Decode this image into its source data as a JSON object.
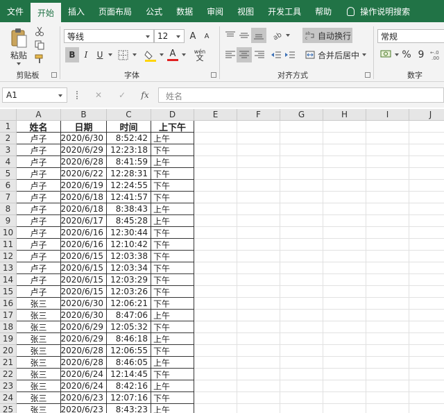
{
  "ribbon": {
    "tabs": [
      "文件",
      "开始",
      "插入",
      "页面布局",
      "公式",
      "数据",
      "审阅",
      "视图",
      "开发工具",
      "帮助"
    ],
    "active_tab": "开始",
    "search_label": "操作说明搜索",
    "clipboard": {
      "paste_label": "粘贴",
      "group_label": "剪贴板"
    },
    "font": {
      "family": "等线",
      "size": "12",
      "bold": "B",
      "italic": "I",
      "underline": "U",
      "color_letter": "A",
      "grow": "A",
      "shrink": "A",
      "wen": "wén",
      "wen_char": "文",
      "group_label": "字体"
    },
    "alignment": {
      "wrap_label": "自动换行",
      "merge_label": "合并后居中",
      "group_label": "对齐方式"
    },
    "number": {
      "format": "常规",
      "percent": "%",
      "comma": "9",
      "group_label": "数字"
    },
    "colors": {
      "accent": "#217346",
      "font_red": "#e02020",
      "fill_yellow": "#ffd400"
    }
  },
  "formula_bar": {
    "cell_ref": "A1",
    "fx": "fx",
    "value": "姓名",
    "cancel": "✕",
    "enter": "✓"
  },
  "sheet": {
    "columns": [
      "A",
      "B",
      "C",
      "D",
      "E",
      "F",
      "G",
      "H",
      "I",
      "J"
    ],
    "headers": [
      "姓名",
      "日期",
      "时间",
      "上下午"
    ],
    "rows": [
      [
        "卢子",
        "2020/6/30",
        "8:52:42",
        "上午"
      ],
      [
        "卢子",
        "2020/6/29",
        "12:23:18",
        "下午"
      ],
      [
        "卢子",
        "2020/6/28",
        "8:41:59",
        "上午"
      ],
      [
        "卢子",
        "2020/6/22",
        "12:28:31",
        "下午"
      ],
      [
        "卢子",
        "2020/6/19",
        "12:24:55",
        "下午"
      ],
      [
        "卢子",
        "2020/6/18",
        "12:41:57",
        "下午"
      ],
      [
        "卢子",
        "2020/6/18",
        "8:38:43",
        "上午"
      ],
      [
        "卢子",
        "2020/6/17",
        "8:45:28",
        "上午"
      ],
      [
        "卢子",
        "2020/6/16",
        "12:30:44",
        "下午"
      ],
      [
        "卢子",
        "2020/6/16",
        "12:10:42",
        "下午"
      ],
      [
        "卢子",
        "2020/6/15",
        "12:03:38",
        "下午"
      ],
      [
        "卢子",
        "2020/6/15",
        "12:03:34",
        "下午"
      ],
      [
        "卢子",
        "2020/6/15",
        "12:03:29",
        "下午"
      ],
      [
        "卢子",
        "2020/6/15",
        "12:03:26",
        "下午"
      ],
      [
        "张三",
        "2020/6/30",
        "12:06:21",
        "下午"
      ],
      [
        "张三",
        "2020/6/30",
        "8:47:06",
        "上午"
      ],
      [
        "张三",
        "2020/6/29",
        "12:05:32",
        "下午"
      ],
      [
        "张三",
        "2020/6/29",
        "8:46:18",
        "上午"
      ],
      [
        "张三",
        "2020/6/28",
        "12:06:55",
        "下午"
      ],
      [
        "张三",
        "2020/6/28",
        "8:46:05",
        "上午"
      ],
      [
        "张三",
        "2020/6/24",
        "12:14:45",
        "下午"
      ],
      [
        "张三",
        "2020/6/24",
        "8:42:16",
        "上午"
      ],
      [
        "张三",
        "2020/6/23",
        "12:07:16",
        "下午"
      ],
      [
        "张三",
        "2020/6/23",
        "8:43:23",
        "上午"
      ]
    ]
  }
}
